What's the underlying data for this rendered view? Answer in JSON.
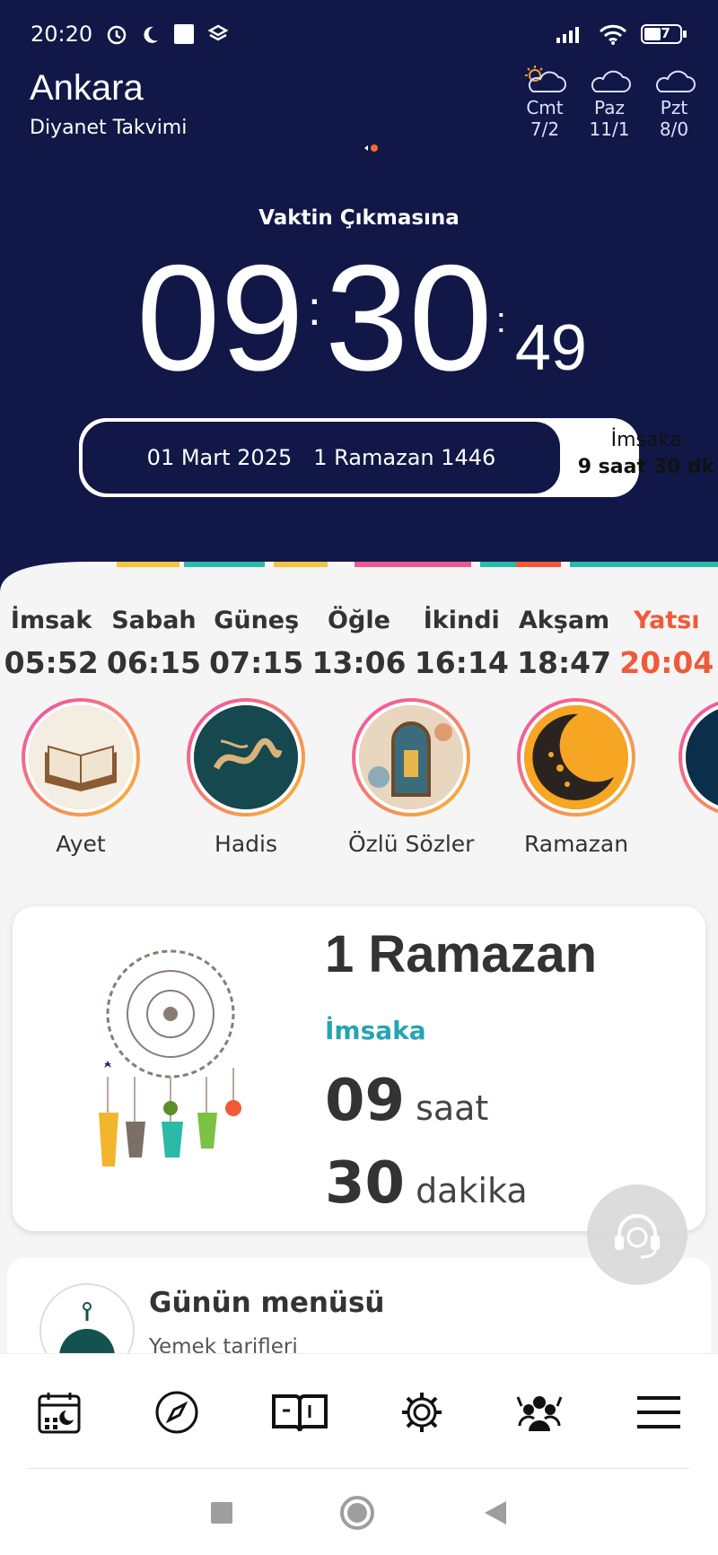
{
  "status": {
    "time": "20:20",
    "battery": "47"
  },
  "header": {
    "city": "Ankara",
    "source": "Diyanet Takvimi"
  },
  "weather": [
    {
      "day": "Cmt",
      "temp": "7/2",
      "icon": "partly-cloudy-icon"
    },
    {
      "day": "Paz",
      "temp": "11/1",
      "icon": "cloud-icon"
    },
    {
      "day": "Pzt",
      "temp": "8/0",
      "icon": "cloud-icon"
    }
  ],
  "countdown": {
    "label": "Vaktin Çıkmasına",
    "hours": "09",
    "minutes": "30",
    "seconds": "49"
  },
  "dates": {
    "gregorian": "01 Mart 2025",
    "hijri": "1 Ramazan 1446",
    "next_name": "İmsaka",
    "next_remaining": "9 saat 30 dk"
  },
  "prayers": [
    {
      "name": "İmsak",
      "time": "05:52"
    },
    {
      "name": "Sabah",
      "time": "06:15"
    },
    {
      "name": "Güneş",
      "time": "07:15"
    },
    {
      "name": "Öğle",
      "time": "13:06"
    },
    {
      "name": "İkindi",
      "time": "16:14"
    },
    {
      "name": "Akşam",
      "time": "18:47"
    },
    {
      "name": "Yatsı",
      "time": "20:04"
    }
  ],
  "stories": [
    "Ayet",
    "Hadis",
    "Özlü Sözler",
    "Ramazan"
  ],
  "ramadan": {
    "title": "1 Ramazan",
    "subtitle": "İmsaka",
    "hours": "09",
    "hours_unit": "saat",
    "minutes": "30",
    "minutes_unit": "dakika"
  },
  "menu_card": {
    "title": "Günün menüsü",
    "subtitle": "Yemek tarifleri"
  },
  "tabs": [
    "calendar-moon-icon",
    "compass-icon",
    "quran-book-icon",
    "settings-icon",
    "community-icon",
    "menu-icon"
  ],
  "colors": {
    "hero": "#111848",
    "accent": "#ef5a37",
    "teal": "#26a4b3"
  }
}
